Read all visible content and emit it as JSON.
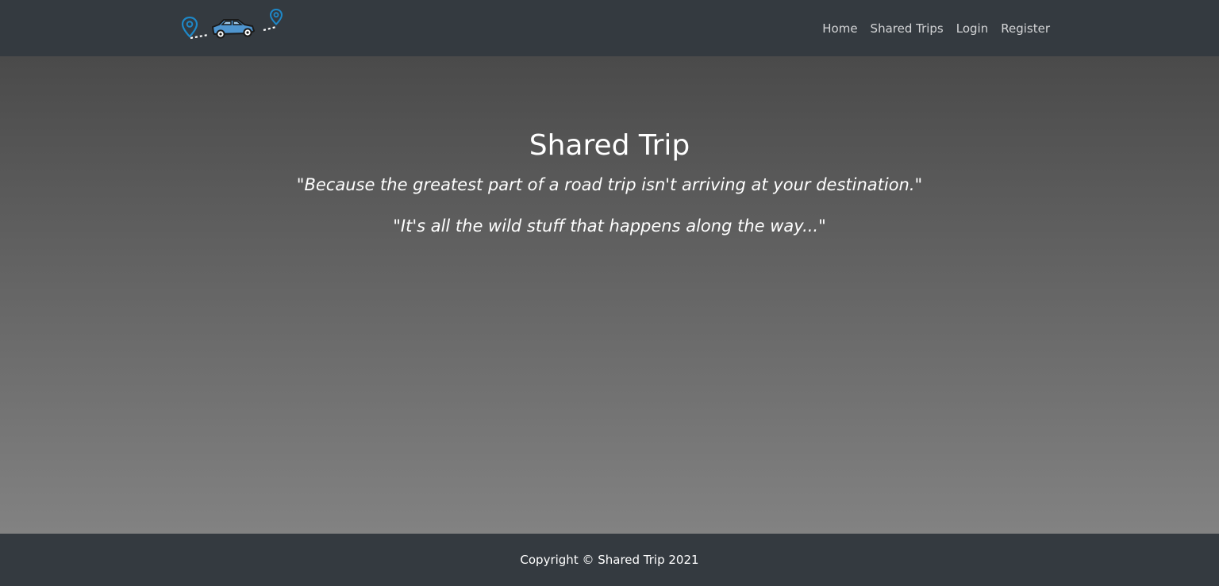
{
  "nav": {
    "logo_icon": "road-trip-car-logo",
    "links": [
      {
        "label": "Home"
      },
      {
        "label": "Shared Trips"
      },
      {
        "label": "Login"
      },
      {
        "label": "Register"
      }
    ]
  },
  "hero": {
    "title": "Shared Trip",
    "quotes": [
      "\"Because the greatest part of a road trip isn't arriving at your destination.\"",
      "\"It's all the wild stuff that happens along the way...\""
    ]
  },
  "footer": {
    "copyright": "Copyright © Shared Trip 2021"
  },
  "colors": {
    "navbar": "#343a40",
    "pin_blue": "#1e88c8",
    "car_blue": "#4f95cf",
    "hero_top": "#4a4a4a",
    "hero_bottom": "#828282"
  }
}
